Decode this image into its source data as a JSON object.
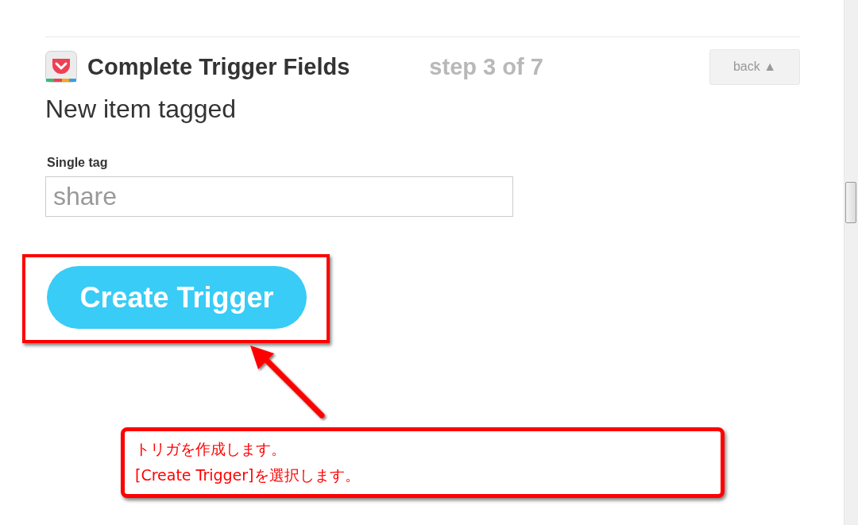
{
  "header": {
    "title": "Complete Trigger Fields",
    "step": "step 3 of 7",
    "back_button": "back ▲"
  },
  "trigger_name": "New item tagged",
  "field": {
    "label": "Single tag",
    "placeholder": "share"
  },
  "create_button": "Create Trigger",
  "annotation": {
    "lines": [
      "トリガを作成します。",
      "[Create Trigger]を選択します。"
    ]
  }
}
